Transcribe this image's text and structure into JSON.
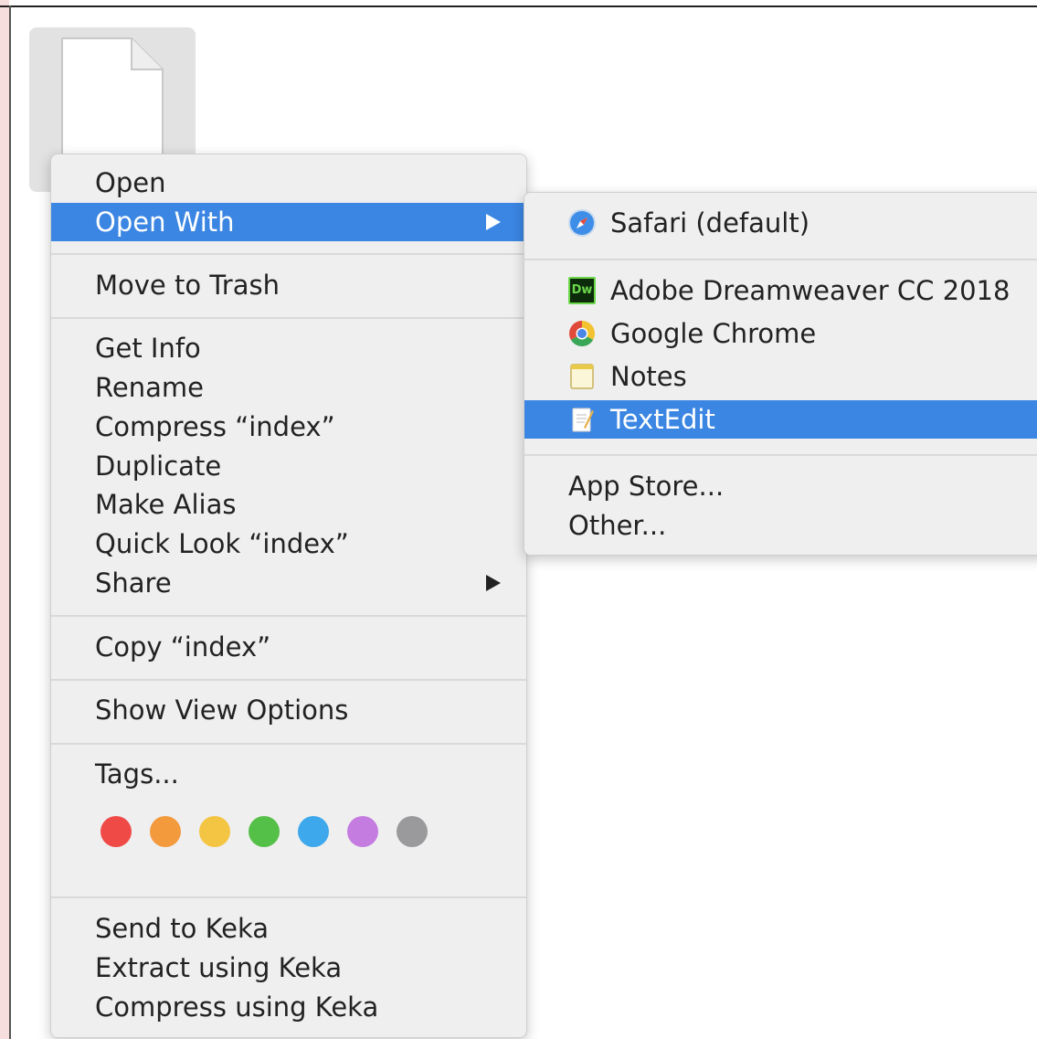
{
  "context_menu": {
    "items": [
      {
        "label": "Open"
      },
      {
        "label": "Open With"
      },
      {
        "label": "Move to Trash"
      },
      {
        "label": "Get Info"
      },
      {
        "label": "Rename"
      },
      {
        "label": "Compress “index”"
      },
      {
        "label": "Duplicate"
      },
      {
        "label": "Make Alias"
      },
      {
        "label": "Quick Look “index”"
      },
      {
        "label": "Share"
      },
      {
        "label": "Copy “index”"
      },
      {
        "label": "Show View Options"
      },
      {
        "label": "Tags..."
      },
      {
        "label": "Send to Keka"
      },
      {
        "label": "Extract using Keka"
      },
      {
        "label": "Compress using Keka"
      }
    ],
    "tag_colors": [
      "#f04a46",
      "#f39a3d",
      "#f4c443",
      "#55c048",
      "#3ea8ec",
      "#c47ce0",
      "#9a9a9c"
    ],
    "highlight_color": "#3b86e3"
  },
  "open_with_submenu": {
    "items": [
      {
        "label": "Safari (default)",
        "icon": "safari-icon"
      },
      {
        "label": "Adobe Dreamweaver CC 2018",
        "icon": "dreamweaver-icon"
      },
      {
        "label": "Google Chrome",
        "icon": "chrome-icon"
      },
      {
        "label": "Notes",
        "icon": "notes-icon"
      },
      {
        "label": "TextEdit",
        "icon": "textedit-icon"
      },
      {
        "label": "App Store..."
      },
      {
        "label": "Other..."
      }
    ],
    "dreamweaver_icon_text": "Dw"
  }
}
